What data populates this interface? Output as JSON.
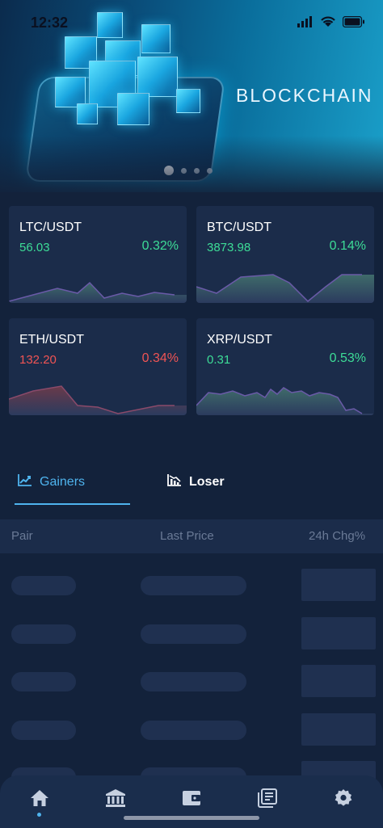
{
  "status_bar": {
    "time": "12:32"
  },
  "banner": {
    "title": "BLOCKCHAIN",
    "slide_count": 4,
    "active_slide": 0
  },
  "markets": [
    {
      "pair": "LTC/USDT",
      "price": "56.03",
      "change": "0.32%",
      "direction": "up"
    },
    {
      "pair": "BTC/USDT",
      "price": "3873.98",
      "change": "0.14%",
      "direction": "up"
    },
    {
      "pair": "ETH/USDT",
      "price": "132.20",
      "change": "0.34%",
      "direction": "down"
    },
    {
      "pair": "XRP/USDT",
      "price": "0.31",
      "change": "0.53%",
      "direction": "up"
    }
  ],
  "tabs": {
    "gainers": "Gainers",
    "loser": "Loser",
    "active": "gainers"
  },
  "table": {
    "columns": [
      "Pair",
      "Last Price",
      "24h Chg%"
    ]
  },
  "nav": {
    "items": [
      "home-icon",
      "bank-icon",
      "wallet-icon",
      "news-icon",
      "settings-icon"
    ],
    "active": "home-icon"
  },
  "colors": {
    "up": "#3ddc97",
    "down": "#f05454",
    "accent": "#4fb4ee"
  }
}
